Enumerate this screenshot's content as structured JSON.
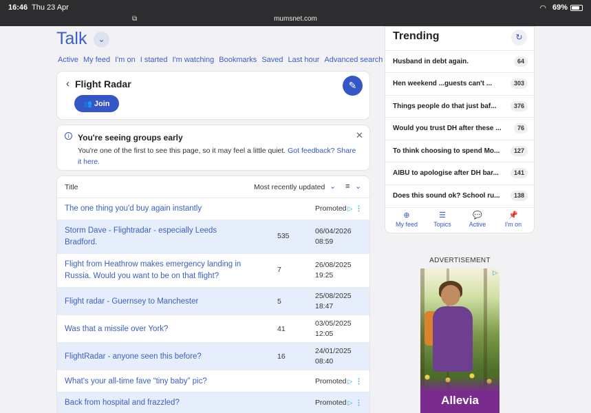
{
  "status_bar": {
    "time": "16:46",
    "date": "Thu 23 Apr",
    "url": "mumsnet.com",
    "battery": "69%"
  },
  "header": {
    "title": "Talk"
  },
  "subnav": [
    "Active",
    "My feed",
    "I'm on",
    "I started",
    "I'm watching",
    "Bookmarks",
    "Saved",
    "Last hour",
    "Advanced search"
  ],
  "group": {
    "title": "Flight Radar",
    "join_label": "Join"
  },
  "notice": {
    "title": "You're seeing groups early",
    "body": "You're one of the first to see this page, so it may feel a little quiet.",
    "link1": "Got feedback?",
    "link2": "Share it here."
  },
  "table": {
    "col_title": "Title",
    "sort_label": "Most recently updated",
    "promoted_label": "Promoted",
    "rows": [
      {
        "title": "The one thing you'd buy again instantly",
        "promoted": true
      },
      {
        "title": "Storm Dave - Flightradar - especially Leeds Bradford.",
        "count": "535",
        "date": "06/04/2026",
        "time": "08:59"
      },
      {
        "title": "Flight from Heathrow makes emergency landing in Russia. Would you want to be on that flight?",
        "count": "7",
        "date": "26/08/2025",
        "time": "19:25"
      },
      {
        "title": "Flight radar - Guernsey to Manchester",
        "count": "5",
        "date": "25/08/2025",
        "time": "18:47"
      },
      {
        "title": "Was that a missile over York?",
        "count": "41",
        "date": "03/05/2025",
        "time": "12:05"
      },
      {
        "title": "FlightRadar - anyone seen this before?",
        "count": "16",
        "date": "24/01/2025",
        "time": "08:40"
      },
      {
        "title": "What's your all-time fave “tiny baby” pic?",
        "promoted": true
      },
      {
        "title": "Back from hospital and frazzled?",
        "promoted": true
      }
    ]
  },
  "trending": {
    "title": "Trending",
    "items": [
      {
        "title": "Husband in debt again.",
        "count": "64"
      },
      {
        "title": "Hen weekend ...guests can't ...",
        "count": "303"
      },
      {
        "title": "Things people do that just baf...",
        "count": "376"
      },
      {
        "title": "Would you trust DH after these ...",
        "count": "76"
      },
      {
        "title": "To think choosing to spend Mo...",
        "count": "127"
      },
      {
        "title": "AIBU to apologise after DH bar...",
        "count": "141"
      },
      {
        "title": "Does this sound ok? School ru...",
        "count": "138"
      }
    ],
    "tabs": [
      "My feed",
      "Topics",
      "Active",
      "I'm on"
    ]
  },
  "ad": {
    "label": "ADVERTISEMENT",
    "brand": "Allevia"
  },
  "colors": {
    "accent": "#3556c6",
    "link": "#3a5fc4",
    "row_alt": "#e7eefb",
    "ad_purple": "#7a2c8e"
  }
}
